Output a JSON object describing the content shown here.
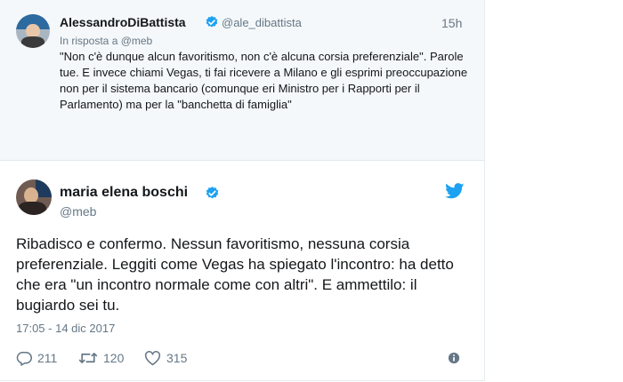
{
  "reply_tweet": {
    "display_name": "AlessandroDiBattista",
    "handle": "@ale_dibattista",
    "time": "15h",
    "in_reply_to": "In risposta a @meb",
    "text": "\"Non c'è dunque alcun favoritismo, non c'è alcuna corsia preferenziale\". Parole tue. E invece chiami Vegas, ti fai ricevere a Milano e gli esprimi preoccupazione non per il sistema bancario (comunque eri Ministro per i Rapporti per il Parlamento) ma per la \"banchetta di famiglia\""
  },
  "main_tweet": {
    "display_name": "maria elena boschi",
    "handle": "@meb",
    "text": "Ribadisco e confermo. Nessun favoritismo, nessuna corsia preferenziale. Leggiti come Vegas ha spiegato l'incontro: ha detto che era \"un incontro normale come con altri\". E ammettilo: il bugiardo sei tu.",
    "timestamp": "17:05 - 14 dic 2017",
    "replies": "211",
    "retweets": "120",
    "likes": "315"
  },
  "colors": {
    "verified": "#1da1f2",
    "twitter_blue": "#1da1f2",
    "muted": "#657786",
    "reply_bg": "#f5f8fa"
  },
  "icons": {
    "verified": "verified-badge-icon",
    "bird": "twitter-bird-icon",
    "reply": "reply-icon",
    "retweet": "retweet-icon",
    "like": "heart-icon",
    "info": "info-icon"
  }
}
